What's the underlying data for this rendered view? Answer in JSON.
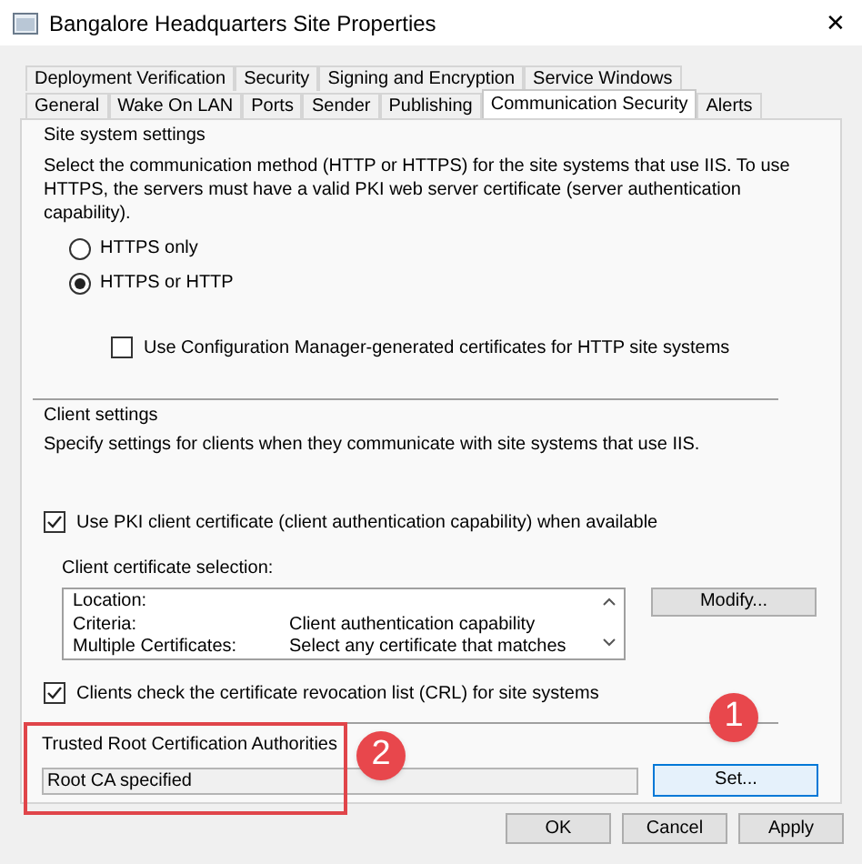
{
  "window": {
    "title": "Bangalore Headquarters Site Properties",
    "close": "✕"
  },
  "tab_rows": [
    {
      "tabs": [
        {
          "label": "Deployment Verification",
          "selected": false
        },
        {
          "label": "Security",
          "selected": false
        },
        {
          "label": "Signing and Encryption",
          "selected": false
        },
        {
          "label": "Service Windows",
          "selected": false
        }
      ]
    },
    {
      "tabs": [
        {
          "label": "General",
          "selected": false
        },
        {
          "label": "Wake On LAN",
          "selected": false
        },
        {
          "label": "Ports",
          "selected": false
        },
        {
          "label": "Sender",
          "selected": false
        },
        {
          "label": "Publishing",
          "selected": false
        },
        {
          "label": "Communication Security",
          "selected": true
        },
        {
          "label": "Alerts",
          "selected": false
        }
      ]
    }
  ],
  "site_system_settings": {
    "heading": "Site system settings",
    "description": "Select the communication method (HTTP or HTTPS) for the site systems that use IIS. To use HTTPS, the servers must have a valid PKI web server certificate (server authentication capability).",
    "options": [
      {
        "label": "HTTPS only",
        "selected": false
      },
      {
        "label": "HTTPS or HTTP",
        "selected": true
      }
    ],
    "use_generated_certificates": {
      "label": "Use Configuration Manager-generated certificates for HTTP site systems",
      "checked": false
    }
  },
  "client_settings": {
    "heading": "Client settings",
    "description": "Specify settings for clients when they communicate with site systems that use IIS.",
    "use_pki": {
      "label": "Use PKI client certificate (client authentication capability) when available",
      "checked": true
    },
    "selection_label": "Client certificate selection:",
    "selection_rows": [
      {
        "name": "Location:",
        "value": ""
      },
      {
        "name": "Criteria:",
        "value": "Client authentication capability"
      },
      {
        "name": "Multiple Certificates:",
        "value": "Select any certificate that matches"
      }
    ],
    "modify_button": "Modify...",
    "check_crl": {
      "label": "Clients check the certificate revocation list (CRL) for site systems",
      "checked": true
    }
  },
  "trusted_root": {
    "heading": "Trusted Root Certification Authorities",
    "value": "Root CA specified",
    "set_button": "Set..."
  },
  "buttons": [
    "OK",
    "Cancel",
    "Apply"
  ],
  "annotations": [
    {
      "kind": "highlight"
    },
    {
      "kind": "marker",
      "label": "1"
    },
    {
      "kind": "marker",
      "label": "2"
    }
  ]
}
